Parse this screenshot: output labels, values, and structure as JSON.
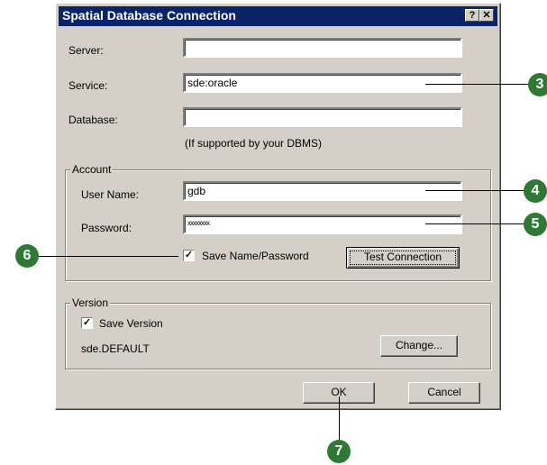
{
  "window": {
    "title": "Spatial Database Connection",
    "help_btn": "?",
    "close_btn": "✕"
  },
  "fields": {
    "server_label": "Server:",
    "server_value": "",
    "service_label": "Service:",
    "service_value": "sde:oracle",
    "database_label": "Database:",
    "database_value": "",
    "database_hint": "(If supported by your DBMS)"
  },
  "account": {
    "group_label": "Account",
    "username_label": "User Name:",
    "username_value": "gdb",
    "password_label": "Password:",
    "password_value": "xxxxxxxx",
    "save_checkbox_label": "Save Name/Password",
    "save_checked": "✓",
    "test_button": "Test Connection"
  },
  "version": {
    "group_label": "Version",
    "save_checkbox_label": "Save Version",
    "save_checked": "✓",
    "current_version": "sde.DEFAULT",
    "change_button": "Change..."
  },
  "buttons": {
    "ok": "OK",
    "cancel": "Cancel"
  },
  "callouts": {
    "c3": "3",
    "c4": "4",
    "c5": "5",
    "c6": "6",
    "c7": "7"
  },
  "colors": {
    "callout": "#2e7a34",
    "titlebar": "#0a246a",
    "face": "#d4d0c8"
  }
}
